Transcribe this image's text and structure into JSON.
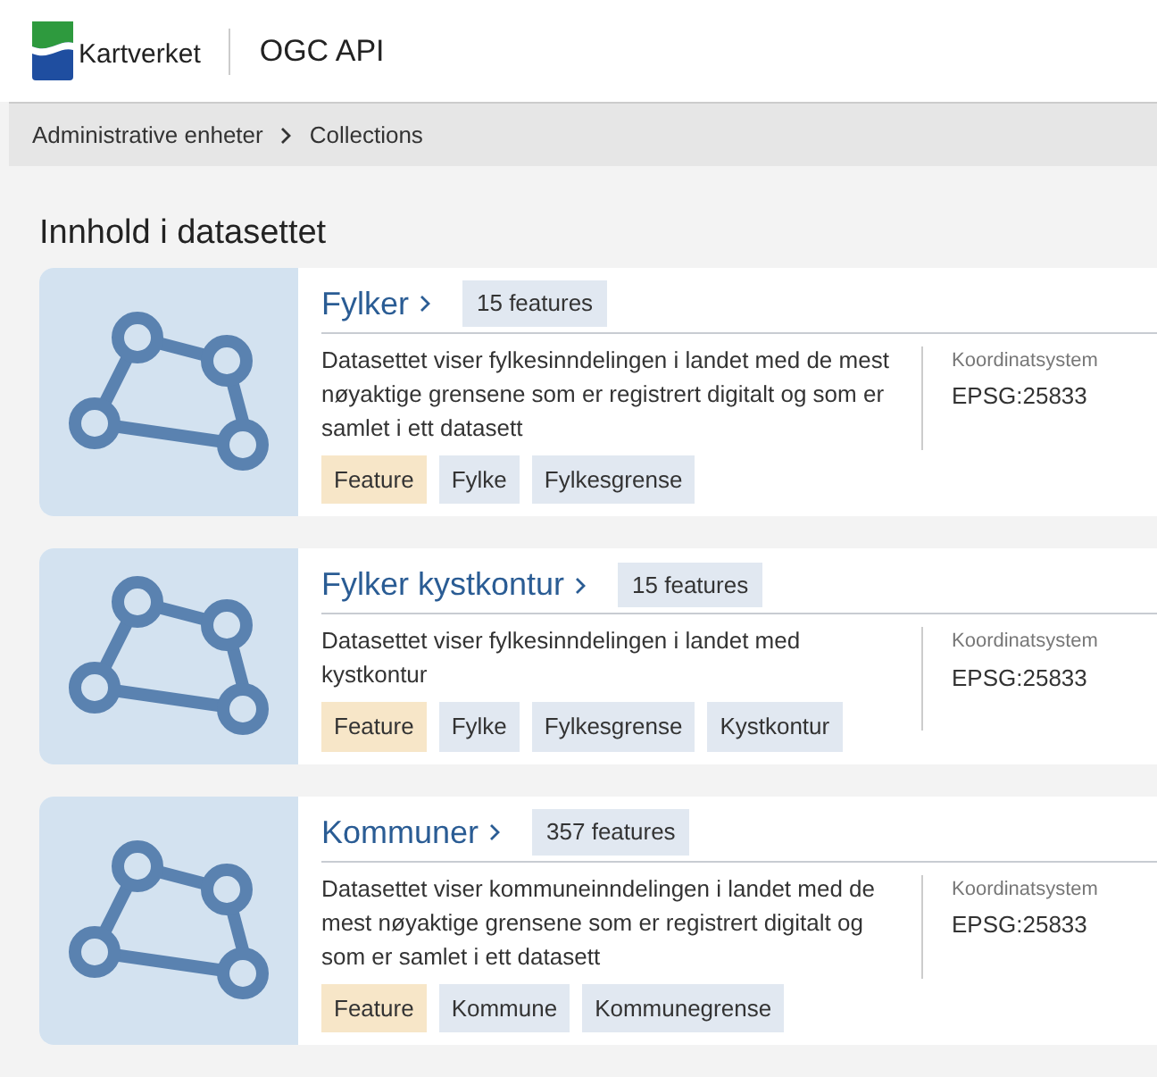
{
  "header": {
    "logo_text": "Kartverket",
    "title": "OGC API"
  },
  "breadcrumb": [
    "Administrative enheter",
    "Collections"
  ],
  "heading": "Innhold i datasettet",
  "collections": [
    {
      "title": "Fylker",
      "count": "15 features",
      "description": "Datasettet viser fylkesinndelingen i landet med de mest nøyaktige grensene som er registrert digitalt og som er samlet i ett datasett",
      "crs_label": "Koordinatsystem",
      "crs": "EPSG:25833",
      "tags": [
        {
          "label": "Feature",
          "kind": "type"
        },
        {
          "label": "Fylke",
          "kind": "keyword"
        },
        {
          "label": "Fylkesgrense",
          "kind": "keyword"
        }
      ]
    },
    {
      "title": "Fylker kystkontur",
      "count": "15 features",
      "description": "Datasettet viser fylkesinndelingen i landet med kystkontur",
      "crs_label": "Koordinatsystem",
      "crs": "EPSG:25833",
      "tags": [
        {
          "label": "Feature",
          "kind": "type"
        },
        {
          "label": "Fylke",
          "kind": "keyword"
        },
        {
          "label": "Fylkesgrense",
          "kind": "keyword"
        },
        {
          "label": "Kystkontur",
          "kind": "keyword"
        }
      ]
    },
    {
      "title": "Kommuner",
      "count": "357 features",
      "description": "Datasettet viser kommuneinndelingen i landet med de mest nøyaktige grensene som er registrert digitalt og som er samlet i ett datasett",
      "crs_label": "Koordinatsystem",
      "crs": "EPSG:25833",
      "tags": [
        {
          "label": "Feature",
          "kind": "type"
        },
        {
          "label": "Kommune",
          "kind": "keyword"
        },
        {
          "label": "Kommunegrense",
          "kind": "keyword"
        }
      ]
    }
  ]
}
